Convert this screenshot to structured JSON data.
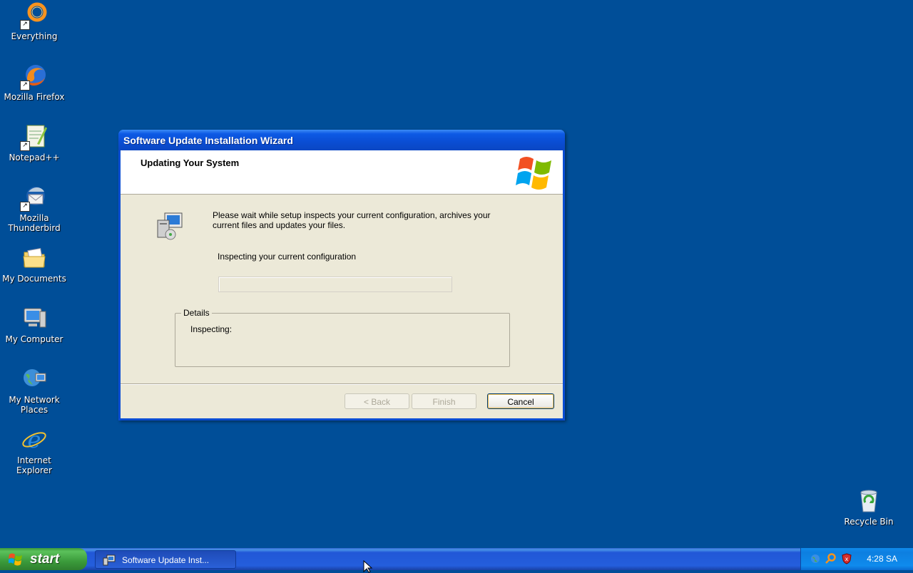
{
  "desktop": {
    "icons": [
      {
        "label": "Everything"
      },
      {
        "label": "Mozilla Firefox"
      },
      {
        "label": "Notepad++"
      },
      {
        "label": "Mozilla Thunderbird"
      },
      {
        "label": "My Documents"
      },
      {
        "label": "My Computer"
      },
      {
        "label": "My Network Places"
      },
      {
        "label": "Internet Explorer"
      },
      {
        "label": "Recycle Bin"
      }
    ]
  },
  "window": {
    "title": "Software Update Installation Wizard",
    "header_title": "Updating Your System",
    "intro_text": "Please wait while setup inspects your current configuration, archives your current files and updates your files.",
    "status_text": "Inspecting your current configuration",
    "progress_fraction": 0,
    "details": {
      "legend": "Details",
      "content": "Inspecting:"
    },
    "buttons": {
      "back": "< Back",
      "finish": "Finish",
      "cancel": "Cancel"
    }
  },
  "taskbar": {
    "start_label": "start",
    "task_label": "Software Update Inst...",
    "clock": "4:28 SA"
  },
  "colors": {
    "desktop_bg": "#004e98",
    "taskbar_blue": "#245edc",
    "start_green": "#3b9b3b",
    "title_blue": "#0a4dd3"
  }
}
